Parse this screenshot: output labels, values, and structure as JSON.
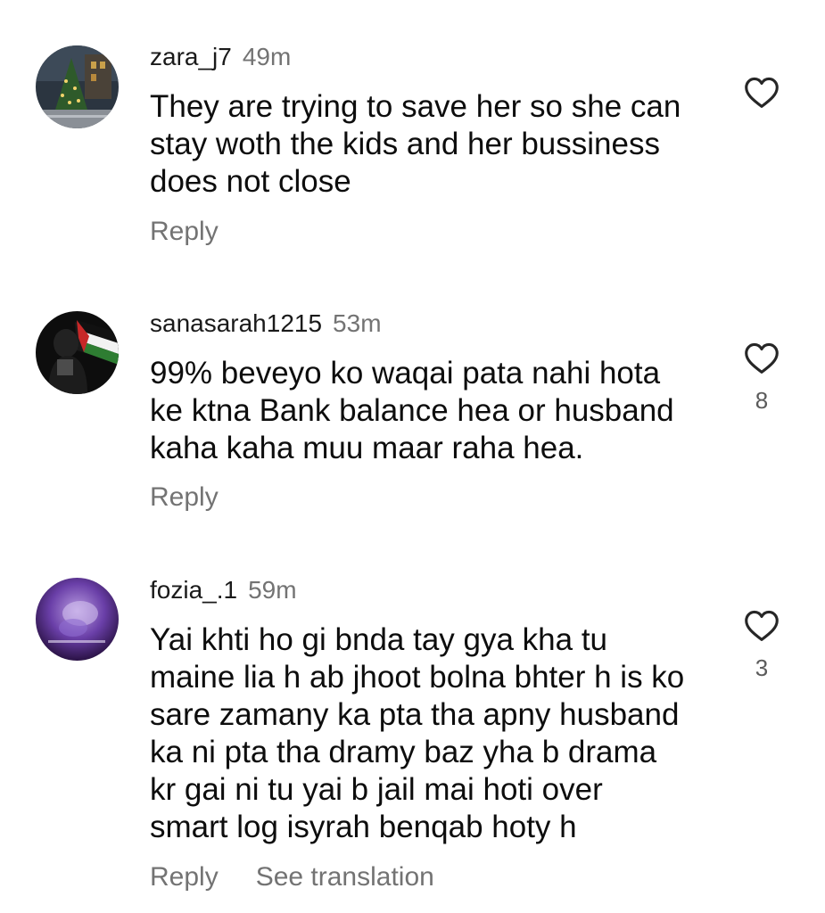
{
  "comments": [
    {
      "username": "zara_j7",
      "time": "49m",
      "lines": [
        "They are trying to save her so she can",
        "stay woth the kids and her bussiness",
        "does not close"
      ],
      "likes": "",
      "reply_label": "Reply",
      "translate_label": ""
    },
    {
      "username": "sanasarah1215",
      "time": "53m",
      "lines": [
        "99% beveyo ko waqai pata nahi hota",
        "ke ktna Bank balance hea or husband",
        "kaha kaha muu maar raha hea."
      ],
      "likes": "8",
      "reply_label": "Reply",
      "translate_label": ""
    },
    {
      "username": "fozia_.1",
      "time": "59m",
      "lines": [
        "Yai khti ho gi bnda tay gya kha tu",
        "maine lia h ab jhoot bolna bhter h is ko",
        "sare zamany ka pta tha apny husband",
        "ka ni pta tha dramy baz yha b drama",
        "kr gai ni tu yai b jail mai hoti over",
        "smart log isyrah benqab hoty h"
      ],
      "likes": "3",
      "reply_label": "Reply",
      "translate_label": "See translation"
    }
  ],
  "colors": {
    "muted_text": "#737373",
    "body_text": "#0d0d0d",
    "icon_stroke": "#262626"
  },
  "icons": {
    "like": "heart-outline-icon"
  }
}
